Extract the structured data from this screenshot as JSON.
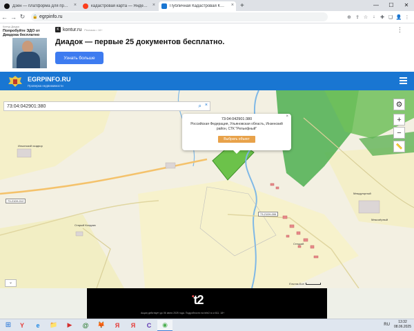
{
  "browser": {
    "tabs": [
      {
        "title": "Дзен — платформа для просмо",
        "favicon_color": "#111111",
        "active": false
      },
      {
        "title": "кадастровая карта — Яндекс: н",
        "favicon_color": "#fc3f1d",
        "active": false
      },
      {
        "title": "Публичная Кадастровая Карта",
        "favicon_color": "#1976d2",
        "active": true
      }
    ],
    "tab_close": "×",
    "new_tab": "+",
    "window_controls": {
      "minimize": "—",
      "maximize": "☐",
      "close": "✕"
    },
    "nav": {
      "back": "←",
      "forward": "→",
      "reload": "↻"
    },
    "url": "egrpinfo.ru",
    "toolbar_icons": [
      "⊕",
      "⇪",
      "☆",
      "↓",
      "✚",
      "❏",
      "👤",
      "⋮"
    ]
  },
  "ad": {
    "small_label": "Контур.Диадок",
    "promo": "Попробуйте ЭДО от Диадока бесплатно",
    "brand": "kontur.ru",
    "brand_tag": "Реклама • 16+",
    "headline": "Диадок — первые 25 документов бесплатно.",
    "button": "Узнать больше",
    "more": "⋮",
    "accent": "#3d7bf0"
  },
  "site": {
    "name": "EGRPINFO.RU",
    "tagline": "Проверка недвижимости",
    "header_color": "#1976d2"
  },
  "map": {
    "search_value": "73:04:042901:380",
    "search_icon": "⌕",
    "clear_icon": "×",
    "popup": {
      "cadastral_number": "73:04:042901:380",
      "address": "Российская Федерация, Ульяновская область, Инзенский район, СТК \"Рельефный\"",
      "select_button": "Выбрать объект",
      "close": "×"
    },
    "labels": {
      "village1": "Ильинский хоздвор",
      "village2": "Старый Колдаис",
      "village3": "Междугорный",
      "village4": "Межозёрный",
      "village5": "Стецкий"
    },
    "road_badges": [
      "73-210Н-012",
      "73-210Н-006"
    ],
    "scale_label": "Ельник-Бол",
    "controls": {
      "settings": "⚙",
      "zoom_in": "+",
      "zoom_out": "−",
      "ruler": "📏",
      "collapse": "⌄"
    }
  },
  "banner": {
    "brand": "t2",
    "fine_print": "Акция действует до 06 июня 2025 года. Подробности на tele2.ru и 611. 18+"
  },
  "taskbar": {
    "start": "⊞",
    "apps": [
      "Y",
      "e",
      "📁",
      "▶",
      "@",
      "🦊",
      "Я",
      "Я",
      "C",
      "◉"
    ],
    "lang": "RU",
    "time": "13:32",
    "date": "08.06.2025"
  }
}
